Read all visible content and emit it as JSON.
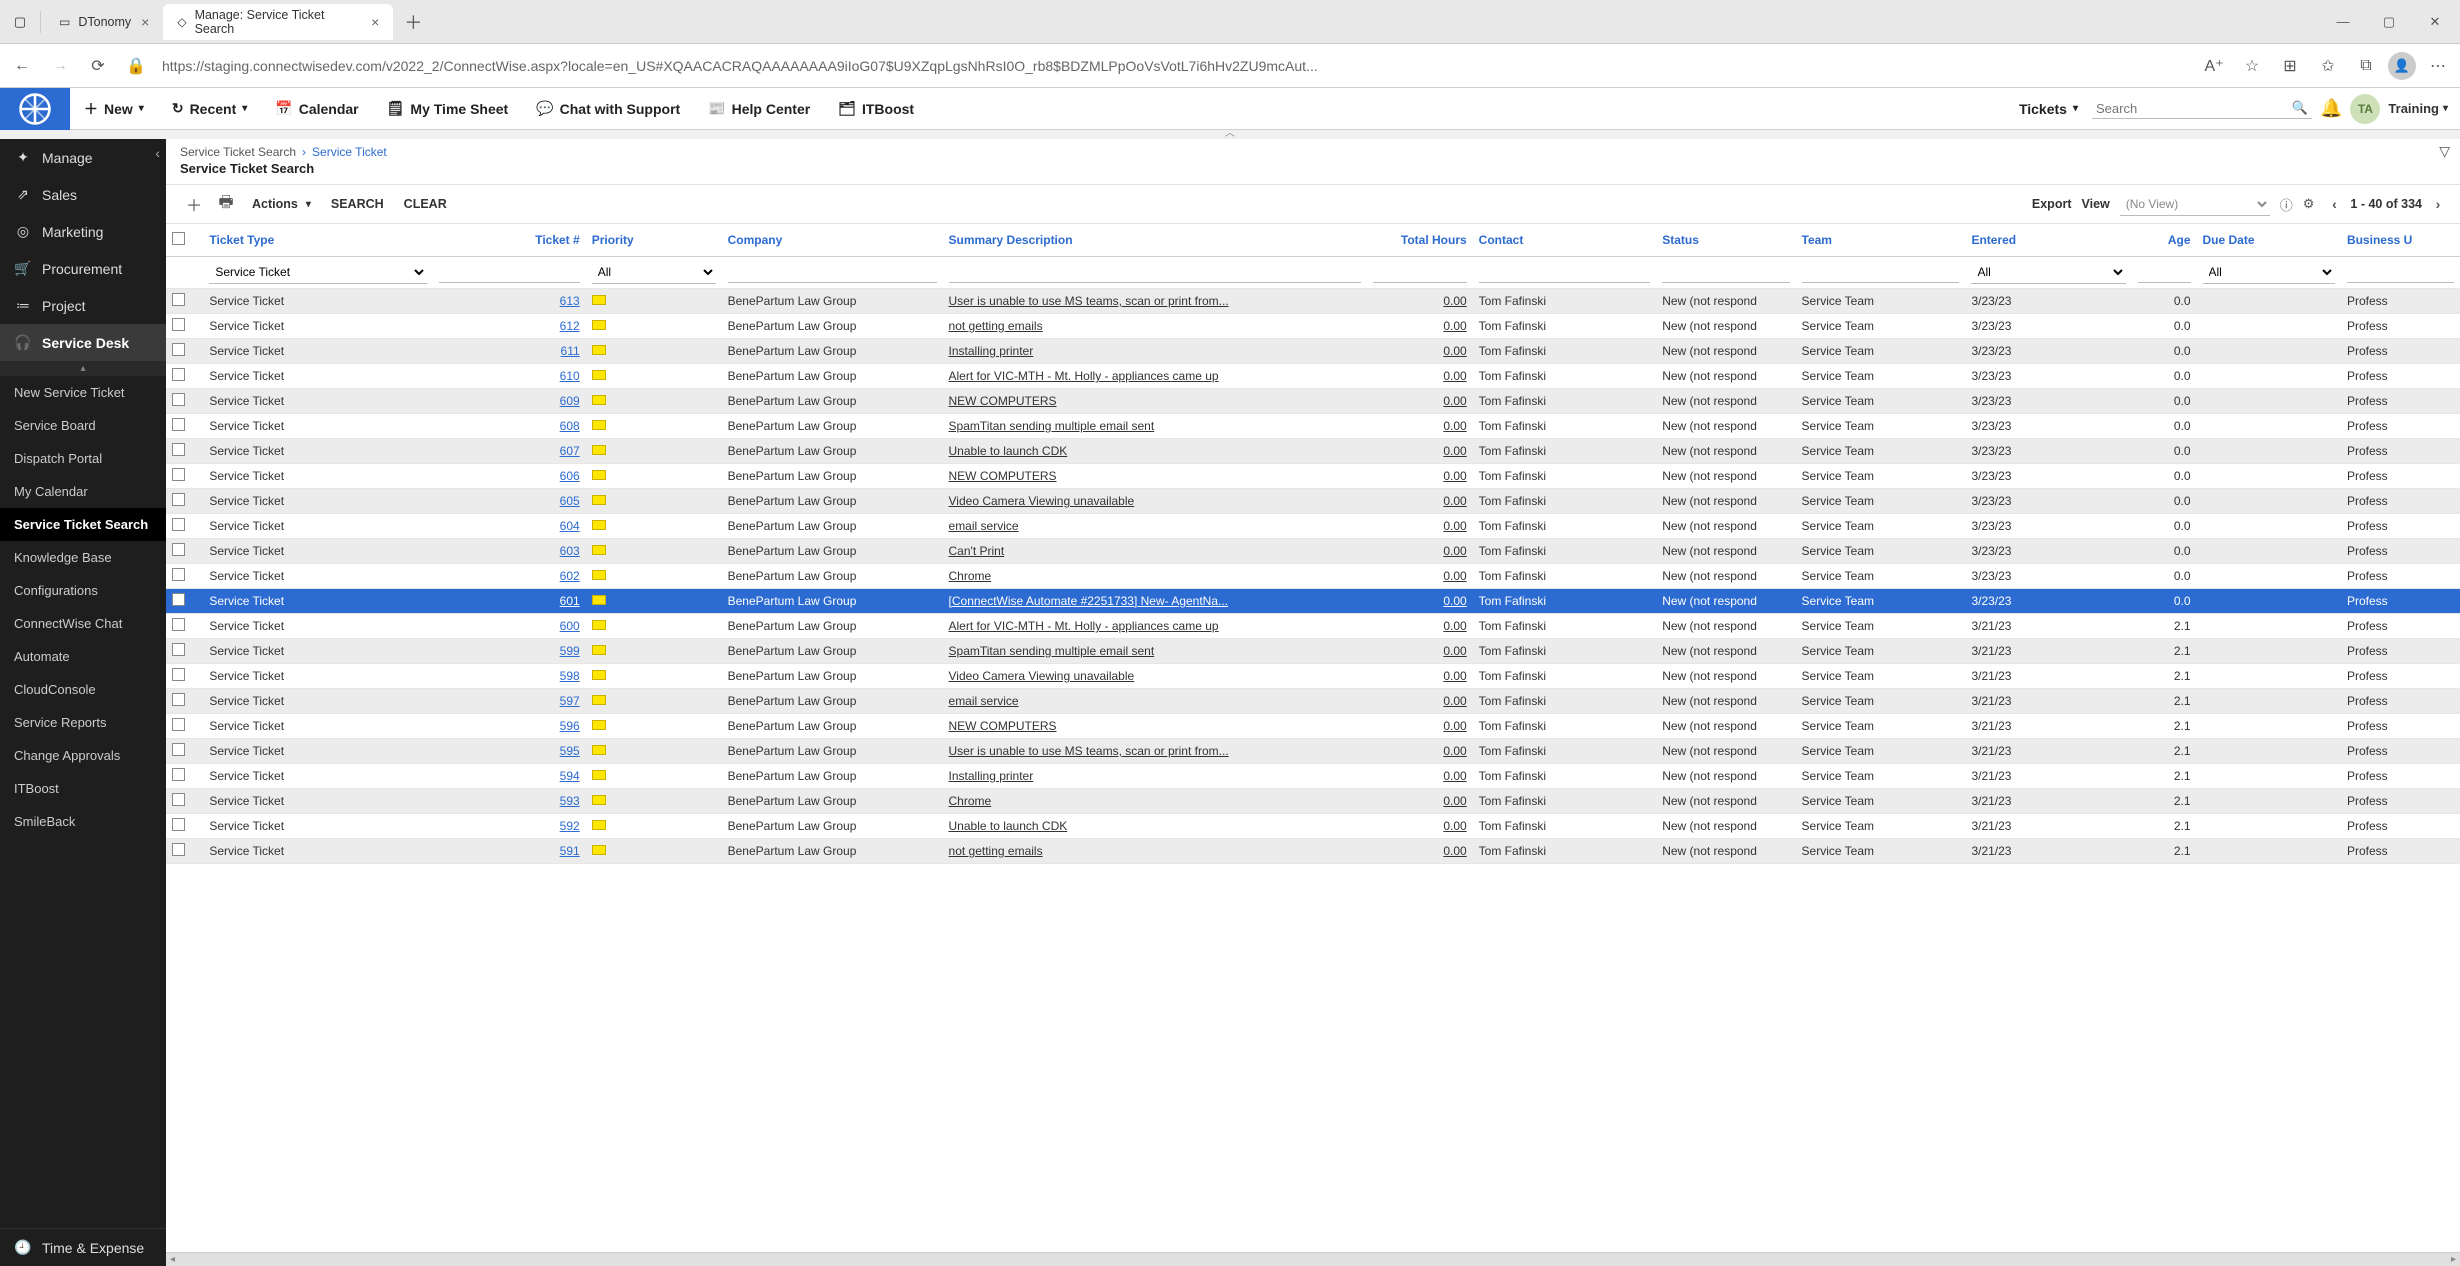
{
  "browser": {
    "tabs": [
      {
        "label": "DTonomy",
        "active": false
      },
      {
        "label": "Manage: Service Ticket Search",
        "active": true
      }
    ],
    "url": "https://staging.connectwisedev.com/v2022_2/ConnectWise.aspx?locale=en_US#XQAACACRAQAAAAAAAA9iIoG07$U9XZqpLgsNhRsI0O_rb8$BDZMLPpOoVsVotL7i6hHv2ZU9mcAut..."
  },
  "topnav": {
    "new": "New",
    "recent": "Recent",
    "calendar": "Calendar",
    "timesheet": "My Time Sheet",
    "chat": "Chat with Support",
    "help": "Help Center",
    "itboost": "ITBoost",
    "ticketsLabel": "Tickets",
    "searchPlaceholder": "Search",
    "userInitials": "TA",
    "userLabel": "Training"
  },
  "leftnav": {
    "top": [
      {
        "label": "Manage",
        "icon": "✦"
      },
      {
        "label": "Sales",
        "icon": "⇗"
      },
      {
        "label": "Marketing",
        "icon": "◎"
      },
      {
        "label": "Procurement",
        "icon": "🛒"
      },
      {
        "label": "Project",
        "icon": "≔"
      }
    ],
    "activeParent": {
      "label": "Service Desk",
      "icon": "🎧"
    },
    "subs": [
      "New Service Ticket",
      "Service Board",
      "Dispatch Portal",
      "My Calendar",
      "Service Ticket Search",
      "Knowledge Base",
      "Configurations",
      "ConnectWise Chat",
      "Automate",
      "CloudConsole",
      "Service Reports",
      "Change Approvals",
      "ITBoost",
      "SmileBack"
    ],
    "activeSub": "Service Ticket Search",
    "bottom": {
      "label": "Time & Expense",
      "icon": "🕘"
    }
  },
  "breadcrumb": {
    "root": "Service Ticket Search",
    "current": "Service Ticket",
    "pageTitle": "Service Ticket Search"
  },
  "toolbar": {
    "actions": "Actions",
    "search": "SEARCH",
    "clear": "CLEAR",
    "export": "Export",
    "view": "View",
    "viewPlaceholder": "(No View)",
    "pager": "1 - 40 of 334"
  },
  "columns": {
    "ticketType": "Ticket Type",
    "ticketNum": "Ticket #",
    "priority": "Priority",
    "company": "Company",
    "summary": "Summary Description",
    "totalHours": "Total Hours",
    "contact": "Contact",
    "status": "Status",
    "team": "Team",
    "entered": "Entered",
    "age": "Age",
    "dueDate": "Due Date",
    "businessUnit": "Business U"
  },
  "filters": {
    "ticketType": "Service Ticket",
    "priority": "All",
    "entered": "All",
    "dueDate": "All"
  },
  "defaults": {
    "ticketType": "Service Ticket",
    "company": "BenePartum Law Group",
    "contact": "Tom Fafinski",
    "status": "New (not respond",
    "team": "Service Team",
    "biz": "Profess"
  },
  "rows": [
    {
      "num": "613",
      "summary": "User is unable to use MS teams, scan or print from...",
      "hours": "0.00",
      "date": "3/23/23",
      "age": "0.0"
    },
    {
      "num": "612",
      "summary": "not getting emails",
      "hours": "0.00",
      "date": "3/23/23",
      "age": "0.0"
    },
    {
      "num": "611",
      "summary": "Installing printer",
      "hours": "0.00",
      "date": "3/23/23",
      "age": "0.0"
    },
    {
      "num": "610",
      "summary": "Alert for VIC-MTH - Mt. Holly - appliances came up",
      "hours": "0.00",
      "date": "3/23/23",
      "age": "0.0"
    },
    {
      "num": "609",
      "summary": "NEW COMPUTERS",
      "hours": "0.00",
      "date": "3/23/23",
      "age": "0.0"
    },
    {
      "num": "608",
      "summary": "SpamTitan sending multiple email sent",
      "hours": "0.00",
      "date": "3/23/23",
      "age": "0.0"
    },
    {
      "num": "607",
      "summary": "Unable to launch CDK",
      "hours": "0.00",
      "date": "3/23/23",
      "age": "0.0"
    },
    {
      "num": "606",
      "summary": "NEW COMPUTERS",
      "hours": "0.00",
      "date": "3/23/23",
      "age": "0.0"
    },
    {
      "num": "605",
      "summary": "Video Camera Viewing unavailable",
      "hours": "0.00",
      "date": "3/23/23",
      "age": "0.0"
    },
    {
      "num": "604",
      "summary": "email service",
      "hours": "0.00",
      "date": "3/23/23",
      "age": "0.0"
    },
    {
      "num": "603",
      "summary": "Can't Print",
      "hours": "0.00",
      "date": "3/23/23",
      "age": "0.0"
    },
    {
      "num": "602",
      "summary": "Chrome",
      "hours": "0.00",
      "date": "3/23/23",
      "age": "0.0"
    },
    {
      "num": "601",
      "summary": "[ConnectWise Automate #2251733] New- AgentNa...",
      "hours": "0.00",
      "date": "3/23/23",
      "age": "0.0",
      "selected": true
    },
    {
      "num": "600",
      "summary": "Alert for VIC-MTH - Mt. Holly - appliances came up",
      "hours": "0.00",
      "date": "3/21/23",
      "age": "2.1"
    },
    {
      "num": "599",
      "summary": "SpamTitan sending multiple email sent",
      "hours": "0.00",
      "date": "3/21/23",
      "age": "2.1"
    },
    {
      "num": "598",
      "summary": "Video Camera Viewing unavailable",
      "hours": "0.00",
      "date": "3/21/23",
      "age": "2.1"
    },
    {
      "num": "597",
      "summary": "email service",
      "hours": "0.00",
      "date": "3/21/23",
      "age": "2.1"
    },
    {
      "num": "596",
      "summary": "NEW COMPUTERS",
      "hours": "0.00",
      "date": "3/21/23",
      "age": "2.1"
    },
    {
      "num": "595",
      "summary": "User is unable to use MS teams, scan or print from...",
      "hours": "0.00",
      "date": "3/21/23",
      "age": "2.1"
    },
    {
      "num": "594",
      "summary": "Installing printer",
      "hours": "0.00",
      "date": "3/21/23",
      "age": "2.1"
    },
    {
      "num": "593",
      "summary": "Chrome",
      "hours": "0.00",
      "date": "3/21/23",
      "age": "2.1"
    },
    {
      "num": "592",
      "summary": "Unable to launch CDK",
      "hours": "0.00",
      "date": "3/21/23",
      "age": "2.1"
    },
    {
      "num": "591",
      "summary": "not getting emails",
      "hours": "0.00",
      "date": "3/21/23",
      "age": "2.1"
    }
  ]
}
